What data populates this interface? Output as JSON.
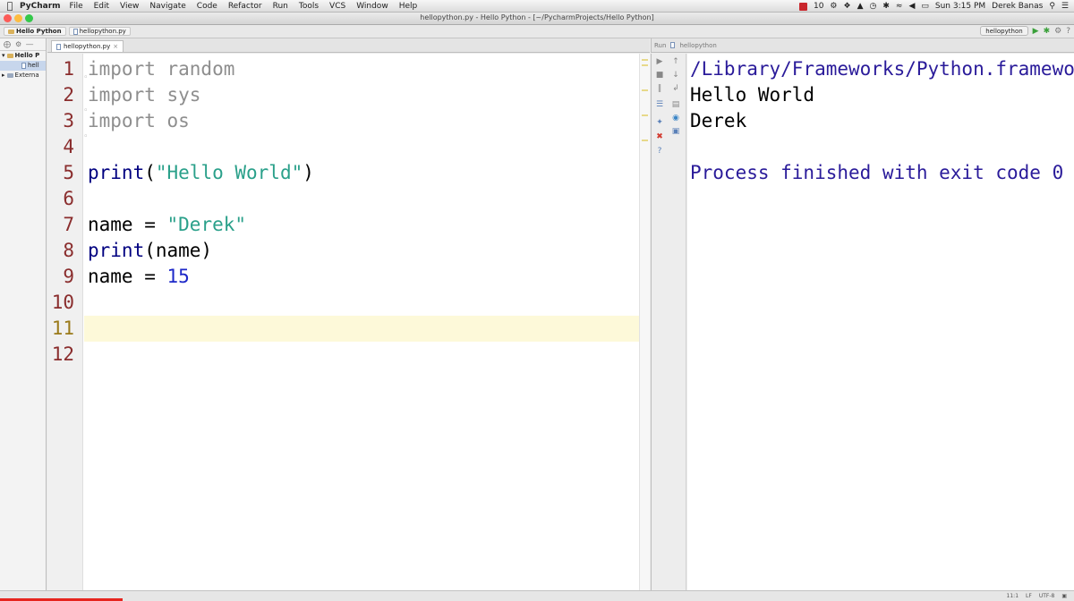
{
  "menubar": {
    "app_name": "PyCharm",
    "menus": [
      "File",
      "Edit",
      "View",
      "Navigate",
      "Code",
      "Refactor",
      "Run",
      "Tools",
      "VCS",
      "Window",
      "Help"
    ],
    "status": {
      "count": "10",
      "datetime": "Sun 3:15 PM",
      "user": "Derek Banas"
    }
  },
  "window": {
    "title": "hellopython.py - Hello Python - [~/PycharmProjects/Hello Python]"
  },
  "navbar": {
    "breadcrumb": [
      "Hello Python",
      "hellopython.py"
    ],
    "run_config": "hellopython"
  },
  "project": {
    "items": [
      {
        "label": "Hello P"
      },
      {
        "label": "hell"
      },
      {
        "label": "Externa"
      }
    ]
  },
  "editor": {
    "tab_label": "hellopython.py",
    "current_line": 11,
    "lines": [
      {
        "no": "1",
        "parts": [
          {
            "t": "import random",
            "c": "kw-unused"
          }
        ]
      },
      {
        "no": "2",
        "parts": [
          {
            "t": "import sys",
            "c": "kw-unused"
          }
        ]
      },
      {
        "no": "3",
        "parts": [
          {
            "t": "import os",
            "c": "kw-unused"
          }
        ]
      },
      {
        "no": "4",
        "parts": []
      },
      {
        "no": "5",
        "parts": [
          {
            "t": "print",
            "c": "fn"
          },
          {
            "t": "(",
            "c": ""
          },
          {
            "t": "\"Hello World\"",
            "c": "str"
          },
          {
            "t": ")",
            "c": ""
          }
        ]
      },
      {
        "no": "6",
        "parts": []
      },
      {
        "no": "7",
        "parts": [
          {
            "t": "name = ",
            "c": ""
          },
          {
            "t": "\"Derek\"",
            "c": "str"
          }
        ]
      },
      {
        "no": "8",
        "parts": [
          {
            "t": "print",
            "c": "fn"
          },
          {
            "t": "(name)",
            "c": ""
          }
        ]
      },
      {
        "no": "9",
        "parts": [
          {
            "t": "name = ",
            "c": ""
          },
          {
            "t": "15",
            "c": "num"
          }
        ]
      },
      {
        "no": "10",
        "parts": []
      },
      {
        "no": "11",
        "parts": []
      },
      {
        "no": "12",
        "parts": []
      }
    ]
  },
  "run_panel": {
    "header_label": "Run",
    "config_label": "hellopython",
    "console": [
      {
        "text": "/Library/Frameworks/Python.framewo",
        "kind": "path"
      },
      {
        "text": "Hello World",
        "kind": "out"
      },
      {
        "text": "Derek",
        "kind": "out"
      },
      {
        "text": "",
        "kind": "out"
      },
      {
        "text": "Process finished with exit code 0",
        "kind": "sys"
      }
    ]
  },
  "statusbar": {
    "position": "11:1",
    "line_sep": "LF",
    "encoding": "UTF-8"
  }
}
